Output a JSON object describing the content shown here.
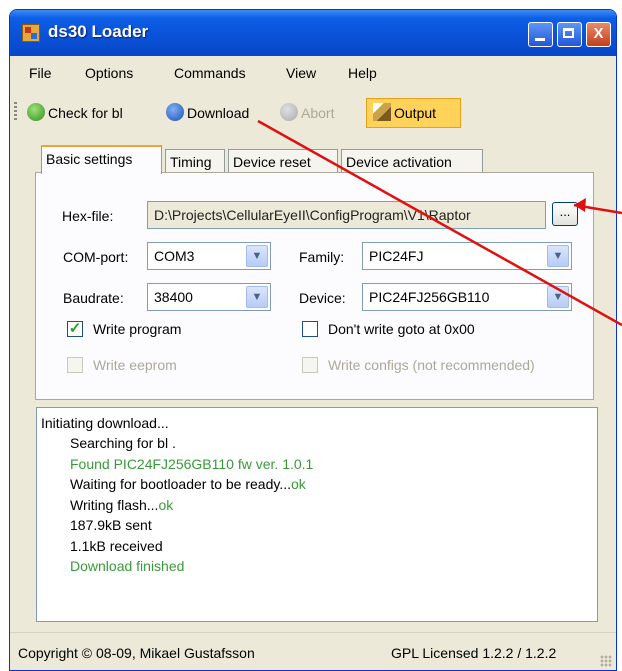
{
  "window": {
    "title": "ds30 Loader",
    "controls": {
      "minimize": "",
      "maximize": "",
      "close": "X"
    }
  },
  "menu": [
    "File",
    "Options",
    "Commands",
    "View",
    "Help"
  ],
  "toolbar": {
    "check_label": "Check for bl",
    "download_label": "Download",
    "abort_label": "Abort",
    "output_label": "Output"
  },
  "tabs": [
    "Basic settings",
    "Timing",
    "Device reset",
    "Device activation"
  ],
  "basic": {
    "hexfile_label": "Hex-file:",
    "hexfile_value": "D:\\Projects\\CellularEyeII\\ConfigProgram\\V1\\Raptor",
    "browse_label": "...",
    "comport_label": "COM-port:",
    "comport_value": "COM3",
    "family_label": "Family:",
    "family_value": "PIC24FJ",
    "baudrate_label": "Baudrate:",
    "baudrate_value": "38400",
    "device_label": "Device:",
    "device_value": "PIC24FJ256GB110",
    "write_program_label": "Write program",
    "write_program_checked": true,
    "dont_write_goto_label": "Don't write goto at 0x00",
    "dont_write_goto_checked": false,
    "write_eeprom_label": "Write eeprom",
    "write_configs_label": "Write configs (not recommended)"
  },
  "log": {
    "lines": [
      "Initiating download...",
      "Searching for bl .",
      "Found PIC24FJ256GB110 fw ver. 1.0.1",
      "Waiting for bootloader to be ready...",
      "ok",
      "Writing flash...",
      "ok",
      "187.9kB sent",
      "1.1kB received",
      "Download finished"
    ]
  },
  "status": {
    "copyright": "Copyright © 08-09, Mikael Gustafsson",
    "license": "GPL Licensed  1.2.2 / 1.2.2"
  },
  "colors": {
    "title_bar": "#0a52d8",
    "log_green": "#3a9a3a",
    "annotation": "#e01010",
    "output_highlight": "#ffd25a"
  },
  "icons": {
    "app": "ds30-loader-icon",
    "check": "refresh-green-icon",
    "download": "download-blue-icon",
    "abort": "abort-grey-icon",
    "output": "output-pen-icon"
  }
}
